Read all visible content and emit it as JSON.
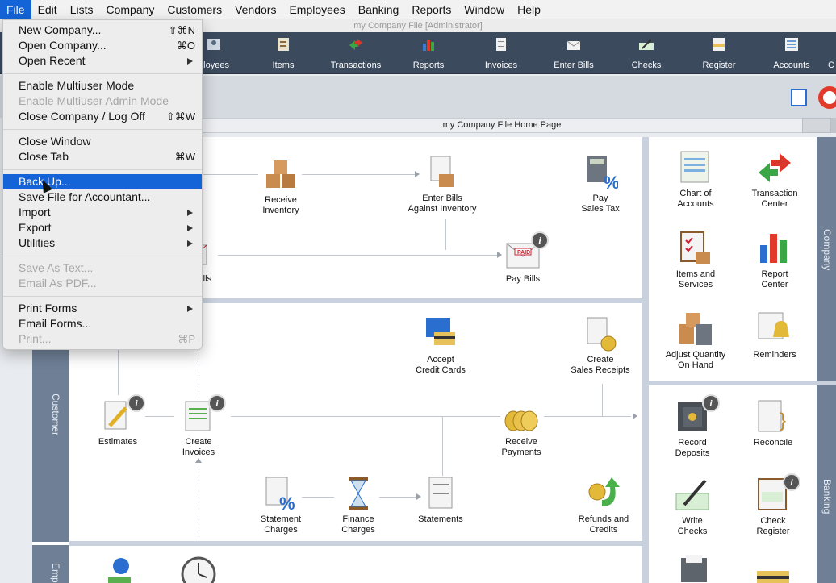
{
  "menubar": {
    "items": [
      "File",
      "Edit",
      "Lists",
      "Company",
      "Customers",
      "Vendors",
      "Employees",
      "Banking",
      "Reports",
      "Window",
      "Help"
    ]
  },
  "window_title": "my Company File [Administrator]",
  "toolbar": {
    "items": [
      "ployees",
      "Items",
      "Transactions",
      "Reports",
      "Invoices",
      "Enter Bills",
      "Checks",
      "Register",
      "Accounts",
      "C"
    ]
  },
  "home_title": "my Company File Home Page",
  "file_menu": {
    "items": [
      {
        "label": "New Company...",
        "shortcut": "⇧⌘N"
      },
      {
        "label": "Open Company...",
        "shortcut": "⌘O"
      },
      {
        "label": "Open Recent",
        "shortcut": ""
      },
      {
        "label": "Enable Multiuser Mode",
        "shortcut": ""
      },
      {
        "label": "Enable Multiuser Admin Mode",
        "shortcut": ""
      },
      {
        "label": "Close Company / Log Off",
        "shortcut": "⇧⌘W"
      },
      {
        "label": "Close Window",
        "shortcut": ""
      },
      {
        "label": "Close Tab",
        "shortcut": "⌘W"
      },
      {
        "label": "Back Up...",
        "shortcut": ""
      },
      {
        "label": "Save File for Accountant...",
        "shortcut": ""
      },
      {
        "label": "Import",
        "shortcut": ""
      },
      {
        "label": "Export",
        "shortcut": ""
      },
      {
        "label": "Utilities",
        "shortcut": ""
      },
      {
        "label": "Save As Text...",
        "shortcut": ""
      },
      {
        "label": "Email As PDF...",
        "shortcut": ""
      },
      {
        "label": "Print Forms",
        "shortcut": ""
      },
      {
        "label": "Email Forms...",
        "shortcut": ""
      },
      {
        "label": "Print...",
        "shortcut": "⌘P"
      }
    ]
  },
  "vendors_section": {
    "receive_inventory": "Receive\nInventory",
    "enter_bills_inventory": "Enter Bills\nAgainst Inventory",
    "pay_sales_tax": "Pay\nSales Tax",
    "enter_bills": "Bills",
    "pay_bills": "Pay Bills"
  },
  "customers_section": {
    "label": "Customer",
    "accept_cc": "Accept\nCredit Cards",
    "sales_receipts": "Create\nSales Receipts",
    "estimates": "Estimates",
    "create_invoices": "Create\nInvoices",
    "receive_payments": "Receive\nPayments",
    "statement_charges": "Statement\nCharges",
    "finance_charges": "Finance\nCharges",
    "statements": "Statements",
    "refunds": "Refunds and\nCredits"
  },
  "employees_section": {
    "label": "Emp"
  },
  "company_section": {
    "label": "Company",
    "chart_of_accounts": "Chart of\nAccounts",
    "transaction_center": "Transaction\nCenter",
    "items_services": "Items and\nServices",
    "report_center": "Report\nCenter",
    "adjust_qty": "Adjust Quantity\nOn Hand",
    "reminders": "Reminders"
  },
  "banking_section": {
    "label": "Banking",
    "record_deposits": "Record\nDeposits",
    "reconcile": "Reconcile",
    "write_checks": "Write\nChecks",
    "check_register": "Check\nRegister"
  },
  "info_glyph": "i",
  "colors": {
    "menu_highlight": "#1464d8",
    "toolbar_bg": "#3c4a5e",
    "sidebar_bg": "#6e7f96"
  }
}
